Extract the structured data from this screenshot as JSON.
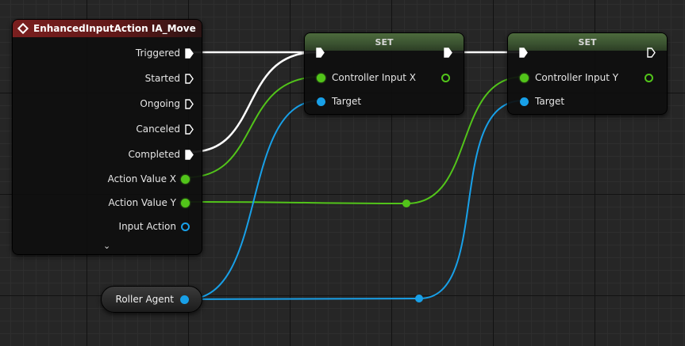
{
  "event_node": {
    "title": "EnhancedInputAction IA_Move",
    "outputs": {
      "triggered": "Triggered",
      "started": "Started",
      "ongoing": "Ongoing",
      "canceled": "Canceled",
      "completed": "Completed",
      "action_value_x": "Action Value X",
      "action_value_y": "Action Value Y",
      "input_action": "Input Action"
    }
  },
  "set_node_x": {
    "title": "SET",
    "variable": "Controller Input X",
    "target": "Target"
  },
  "set_node_y": {
    "title": "SET",
    "variable": "Controller Input Y",
    "target": "Target"
  },
  "variable_node": {
    "label": "Roller Agent"
  },
  "colors": {
    "exec": "#ffffff",
    "float": "#52c41a",
    "object": "#18a0e8",
    "event_header": "#7a1f1f",
    "set_header": "#4d6b3d"
  }
}
